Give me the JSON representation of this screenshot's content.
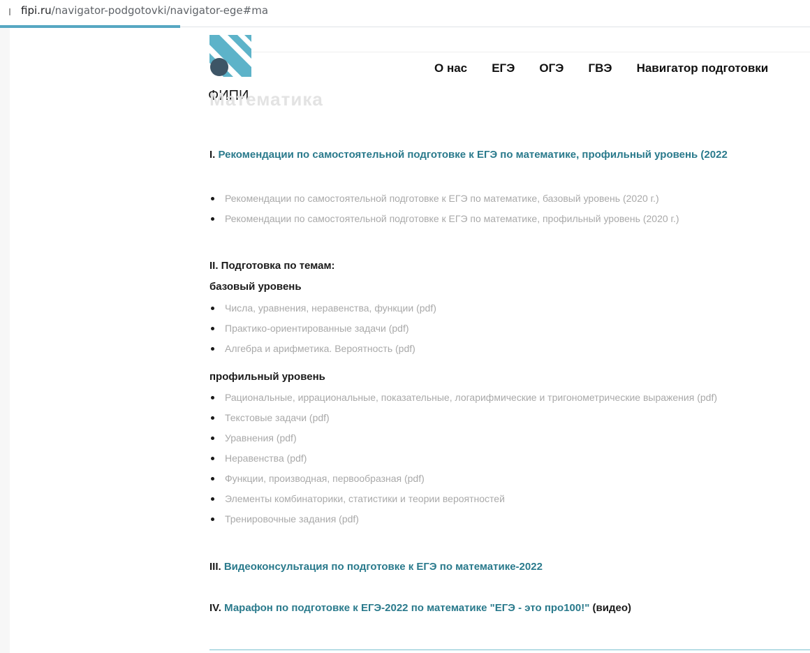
{
  "browser": {
    "url_domain": "fipi.ru",
    "url_path": "/navigator-podgotovki/navigator-ege#ma"
  },
  "site": {
    "logo_text": "ФИПИ",
    "nav": [
      "О нас",
      "ЕГЭ",
      "ОГЭ",
      "ГВЭ",
      "Навигатор подготовки"
    ]
  },
  "page": {
    "ghost_title": "Математика",
    "section1": {
      "num": "I.",
      "title": "Рекомендации по самостоятельной подготовке к ЕГЭ по математике, профильный уровень (2022",
      "items": [
        "Рекомендации по самостоятельной подготовке к ЕГЭ по математике, базовый уровень (2020 г.)",
        "Рекомендации по самостоятельной подготовке к ЕГЭ по математике, профильный уровень (2020 г.)"
      ]
    },
    "section2": {
      "title": "II. Подготовка по темам:",
      "basic_label": "базовый уровень",
      "basic_items": [
        "Числа, уравнения, неравенства, функции (pdf)",
        "Практико-ориентированные задачи (pdf)",
        "Алгебра и арифметика. Вероятность (pdf)"
      ],
      "profile_label": "профильный уровень",
      "profile_items": [
        "Рациональные, иррациональные, показательные, логарифмические и тригонометрические выражения (pdf)",
        "Текстовые задачи (pdf)",
        "Уравнения (pdf)",
        "Неравенства (pdf)",
        "Функции, производная, первообразная (pdf)",
        "Элементы комбинаторики, статистики и теории вероятностей",
        "Тренировочные задания (pdf)"
      ]
    },
    "section3": {
      "num": "III.",
      "title": "Видеоконсультация по подготовке к ЕГЭ по математике-2022"
    },
    "section4": {
      "num": "IV.",
      "title": "Марафон по подготовке к ЕГЭ-2022 по математике \"ЕГЭ - это про100!\"",
      "suffix": " (видео)"
    }
  },
  "colors": {
    "accent": "#2a7a8c",
    "logo_teal": "#5db3c9",
    "logo_dark": "#3d5566",
    "muted_text": "#a9a9a9"
  }
}
